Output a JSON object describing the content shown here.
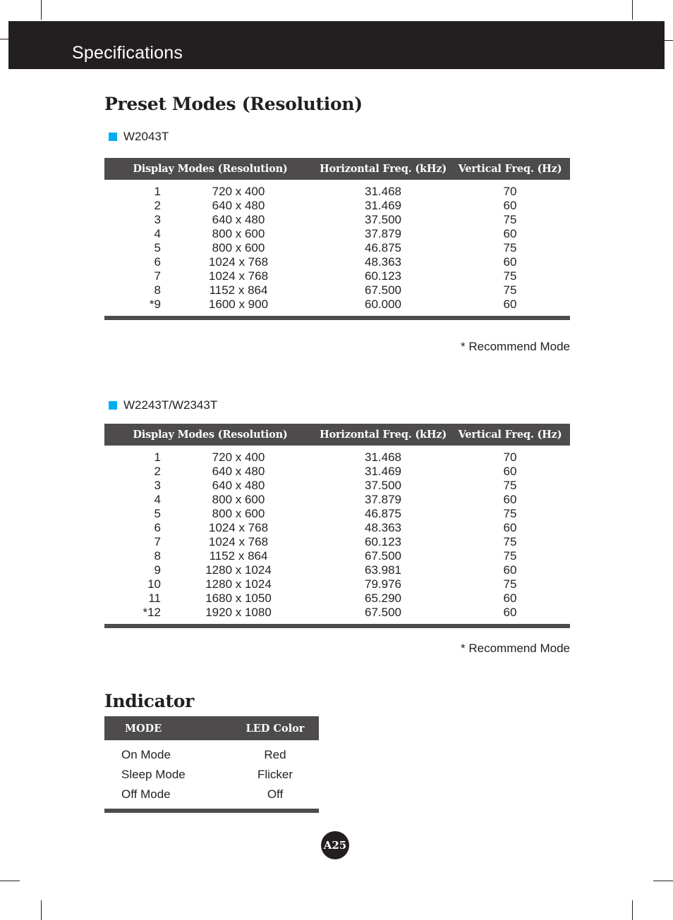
{
  "header": {
    "title": "Specifications"
  },
  "page": {
    "number_badge": "A25"
  },
  "colors": {
    "bullet_blue": "#00aeef",
    "header_bar_black": "#231f20",
    "table_header_gray": "#4d4b4c"
  },
  "preset_modes": {
    "section_title": "Preset Modes (Resolution)",
    "recommend_note": "* Recommend Mode",
    "columns": [
      "Display Modes (Resolution)",
      "Horizontal Freq. (kHz)",
      "Vertical Freq. (Hz)"
    ],
    "tables": [
      {
        "model_label": "W2043T",
        "bullet_icon": "blue-square-bullet",
        "rows": [
          {
            "no": "1",
            "resolution": "720 x 400",
            "hfreq": "31.468",
            "vfreq": "70"
          },
          {
            "no": "2",
            "resolution": "640 x 480",
            "hfreq": "31.469",
            "vfreq": "60"
          },
          {
            "no": "3",
            "resolution": "640 x 480",
            "hfreq": "37.500",
            "vfreq": "75"
          },
          {
            "no": "4",
            "resolution": "800 x 600",
            "hfreq": "37.879",
            "vfreq": "60"
          },
          {
            "no": "5",
            "resolution": "800 x 600",
            "hfreq": "46.875",
            "vfreq": "75"
          },
          {
            "no": "6",
            "resolution": "1024 x 768",
            "hfreq": "48.363",
            "vfreq": "60"
          },
          {
            "no": "7",
            "resolution": "1024 x 768",
            "hfreq": "60.123",
            "vfreq": "75"
          },
          {
            "no": "8",
            "resolution": "1152 x 864",
            "hfreq": "67.500",
            "vfreq": "75"
          },
          {
            "no": "*9",
            "resolution": "1600 x 900",
            "hfreq": "60.000",
            "vfreq": "60"
          }
        ]
      },
      {
        "model_label": "W2243T/W2343T",
        "bullet_icon": "blue-square-bullet",
        "rows": [
          {
            "no": "1",
            "resolution": "720 x 400",
            "hfreq": "31.468",
            "vfreq": "70"
          },
          {
            "no": "2",
            "resolution": "640 x 480",
            "hfreq": "31.469",
            "vfreq": "60"
          },
          {
            "no": "3",
            "resolution": "640 x 480",
            "hfreq": "37.500",
            "vfreq": "75"
          },
          {
            "no": "4",
            "resolution": "800 x 600",
            "hfreq": "37.879",
            "vfreq": "60"
          },
          {
            "no": "5",
            "resolution": "800 x 600",
            "hfreq": "46.875",
            "vfreq": "75"
          },
          {
            "no": "6",
            "resolution": "1024 x 768",
            "hfreq": "48.363",
            "vfreq": "60"
          },
          {
            "no": "7",
            "resolution": "1024 x 768",
            "hfreq": "60.123",
            "vfreq": "75"
          },
          {
            "no": "8",
            "resolution": "1152 x 864",
            "hfreq": "67.500",
            "vfreq": "75"
          },
          {
            "no": "9",
            "resolution": "1280 x 1024",
            "hfreq": "63.981",
            "vfreq": "60"
          },
          {
            "no": "10",
            "resolution": "1280 x 1024",
            "hfreq": "79.976",
            "vfreq": "75"
          },
          {
            "no": "11",
            "resolution": "1680 x 1050",
            "hfreq": "65.290",
            "vfreq": "60"
          },
          {
            "no": "*12",
            "resolution": "1920 x 1080",
            "hfreq": "67.500",
            "vfreq": "60"
          }
        ]
      }
    ]
  },
  "indicator": {
    "section_title": "Indicator",
    "columns": [
      "MODE",
      "LED Color"
    ],
    "rows": [
      {
        "mode": "On Mode",
        "led": "Red"
      },
      {
        "mode": "Sleep Mode",
        "led": "Flicker"
      },
      {
        "mode": "Off Mode",
        "led": "Off"
      }
    ]
  }
}
